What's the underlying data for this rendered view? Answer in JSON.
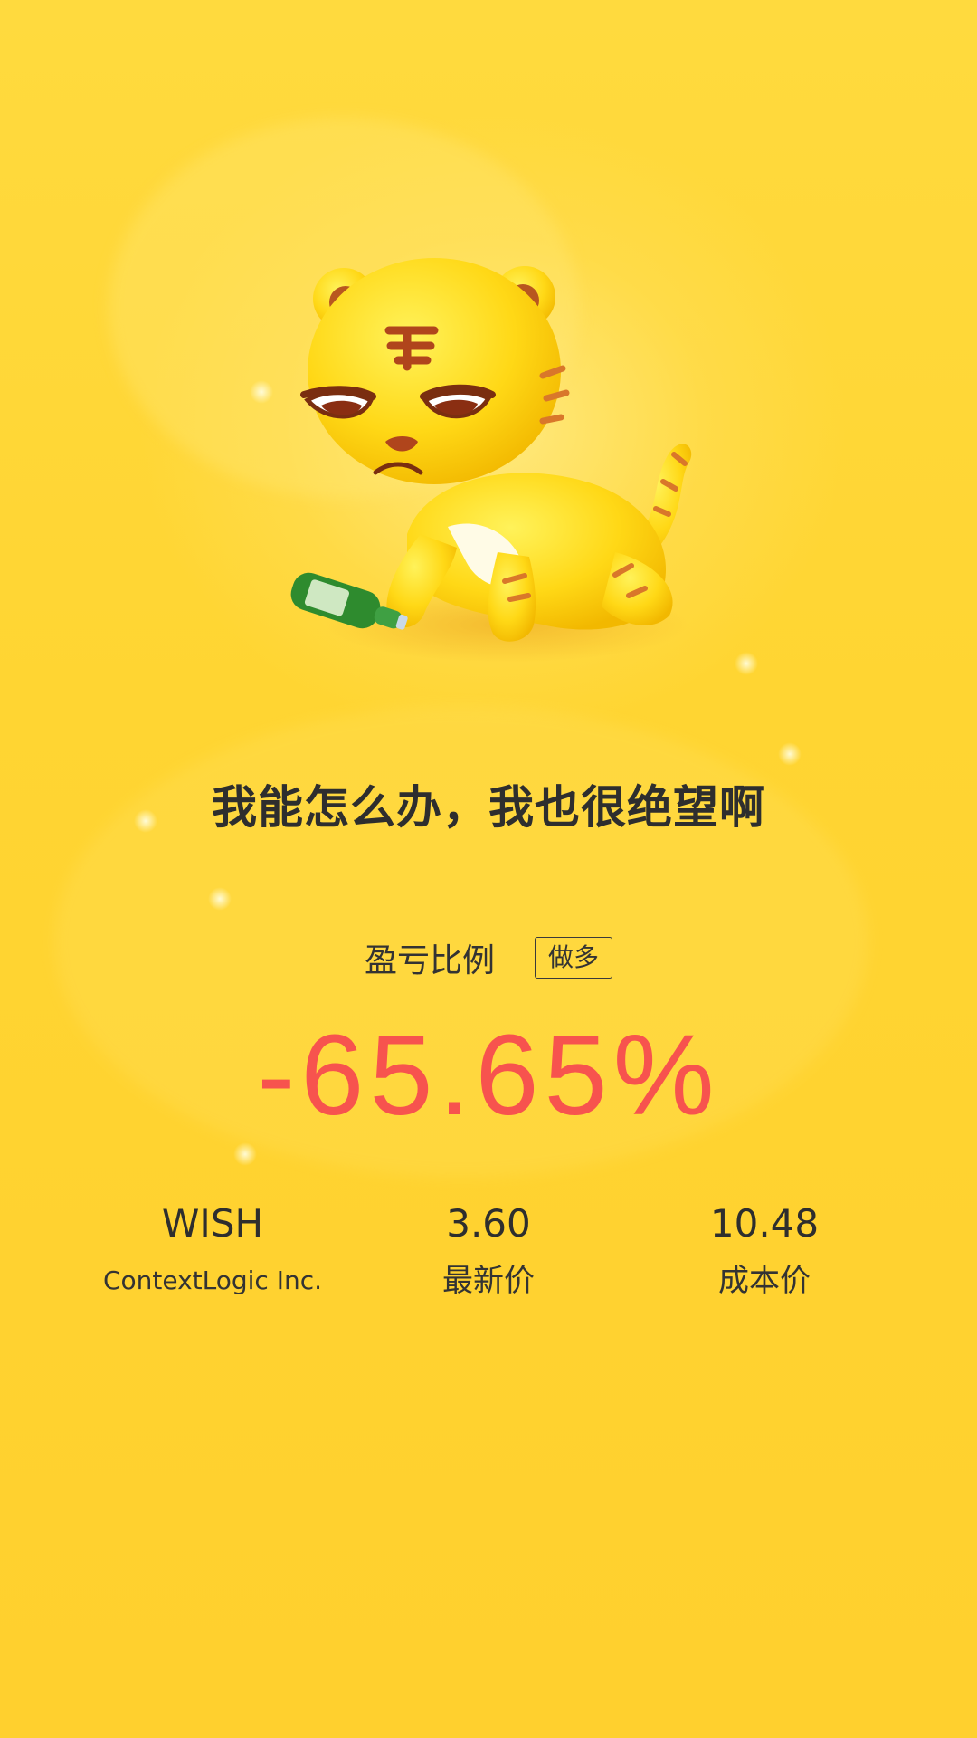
{
  "headline": "我能怎么办，我也很绝望啊",
  "profit_loss": {
    "label": "盈亏比例",
    "position_badge": "做多",
    "value": "-65.65%"
  },
  "stock": {
    "symbol": "WISH",
    "company": "ContextLogic Inc."
  },
  "latest_price": {
    "value": "3.60",
    "label": "最新价"
  },
  "cost_price": {
    "value": "10.48",
    "label": "成本价"
  },
  "colors": {
    "background": "#FFD52E",
    "loss_red": "#F7534E",
    "text_dark": "#2E2E2E"
  },
  "mascot": "sad-tiger-mascot"
}
